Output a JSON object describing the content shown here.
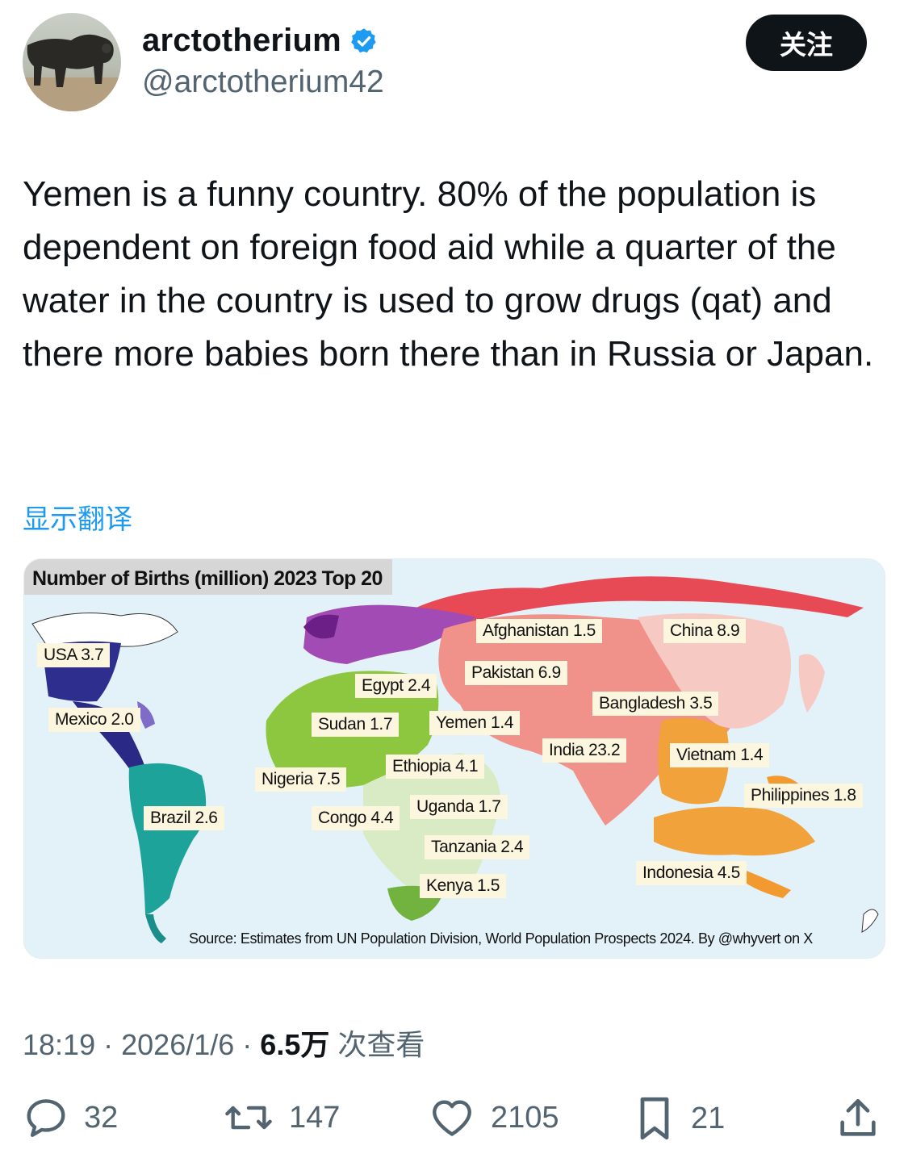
{
  "author": {
    "display_name": "arctotherium",
    "handle": "@arctotherium42",
    "verified_icon": "verified-badge-icon",
    "avatar_icon": "bear-avatar"
  },
  "follow_button": {
    "label": "关注"
  },
  "tweet": {
    "text": "Yemen is a funny country. 80% of the population is dependent on foreign food aid while a quarter of the water in the country is used to grow drugs (qat) and there more babies born there than in Russia or Japan.",
    "translate_label": "显示翻译"
  },
  "media": {
    "title": "Number of Births (million) 2023 Top 20",
    "source": "Source: Estimates from UN Population Division, World Population Prospects 2024. By @whyvert on X",
    "labels": [
      "USA 3.7",
      "Mexico 2.0",
      "Brazil 2.6",
      "Egypt 2.4",
      "Sudan 1.7",
      "Nigeria 7.5",
      "Congo 4.4",
      "Ethiopia 4.1",
      "Yemen 1.4",
      "Uganda 1.7",
      "Tanzania 2.4",
      "Kenya 1.5",
      "Afghanistan 1.5",
      "Pakistan 6.9",
      "India 23.2",
      "Bangladesh 3.5",
      "China 8.9",
      "Vietnam 1.4",
      "Philippines 1.8",
      "Indonesia 4.5"
    ]
  },
  "meta": {
    "time": "18:19",
    "sep1": "·",
    "date": "2026/1/6",
    "sep2": "·",
    "views_count": "6.5万",
    "views_label": "次查看"
  },
  "actions": {
    "reply_count": "32",
    "retweet_count": "147",
    "like_count": "2105",
    "bookmark_count": "21"
  },
  "colors": {
    "follow_bg": "#0f1419",
    "link": "#1d9bf0",
    "secondary_text": "#536471",
    "verified": "#1d9bf0"
  }
}
